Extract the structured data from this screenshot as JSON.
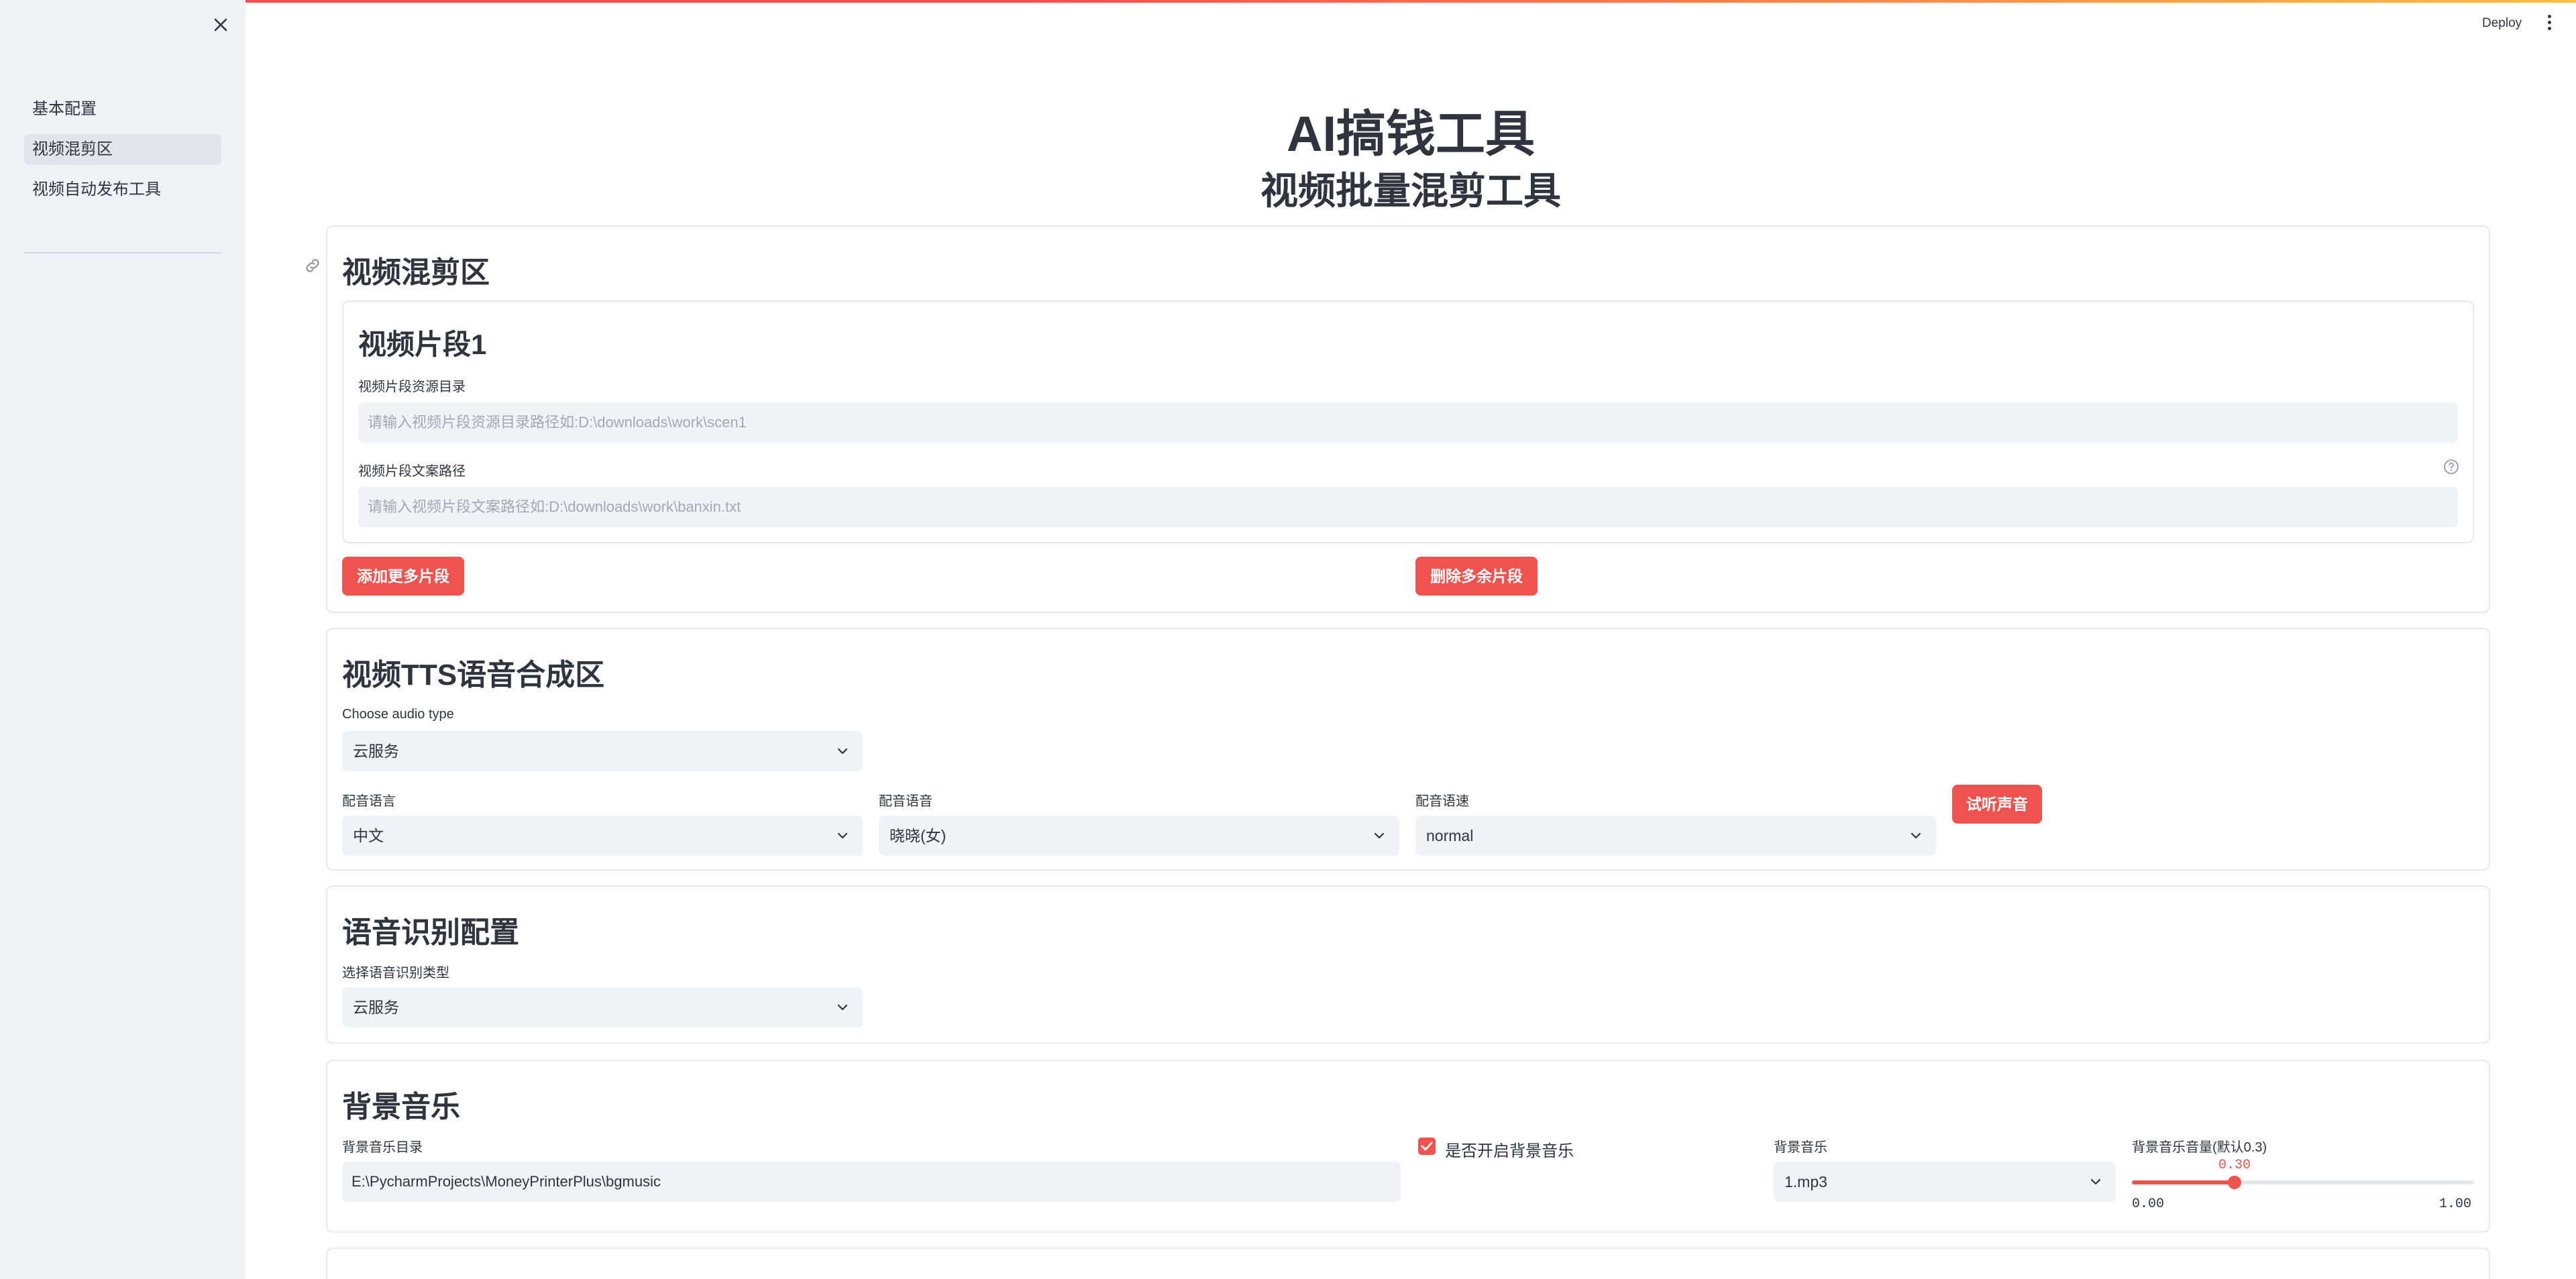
{
  "sidebar": {
    "close_icon": "close-icon",
    "items": [
      {
        "label": "基本配置",
        "active": false
      },
      {
        "label": "视频混剪区",
        "active": true
      },
      {
        "label": "视频自动发布工具",
        "active": false
      }
    ]
  },
  "header": {
    "deploy_label": "Deploy",
    "menu_icon": "vertical-dots-icon"
  },
  "page": {
    "title": "AI搞钱工具",
    "subtitle": "视频批量混剪工具"
  },
  "mix_section": {
    "title": "视频混剪区",
    "segment": {
      "title": "视频片段1",
      "dir_label": "视频片段资源目录",
      "dir_placeholder": "请输入视频片段资源目录路径如:D:\\downloads\\work\\scen1",
      "text_label": "视频片段文案路径",
      "text_placeholder": "请输入视频片段文案路径如:D:\\downloads\\work\\banxin.txt"
    },
    "add_button": "添加更多片段",
    "remove_button": "删除多余片段"
  },
  "tts_section": {
    "title": "视频TTS语音合成区",
    "audio_type_label": "Choose audio type",
    "audio_type_value": "云服务",
    "language_label": "配音语言",
    "language_value": "中文",
    "voice_label": "配音语音",
    "voice_value": "晓晓(女)",
    "speed_label": "配音语速",
    "speed_value": "normal",
    "preview_button": "试听声音"
  },
  "asr_section": {
    "title": "语音识别配置",
    "type_label": "选择语音识别类型",
    "type_value": "云服务"
  },
  "bgm_section": {
    "title": "背景音乐",
    "dir_label": "背景音乐目录",
    "dir_value": "E:\\PycharmProjects\\MoneyPrinterPlus\\bgmusic",
    "enable_label": "是否开启背景音乐",
    "enable_checked": true,
    "music_label": "背景音乐",
    "music_value": "1.mp3",
    "volume_label": "背景音乐音量(默认0.3)",
    "volume_value": "0.30",
    "volume_fraction": 0.3,
    "volume_min": "0.00",
    "volume_max": "1.00"
  },
  "colors": {
    "accent": "#ef5350",
    "sidebar_bg": "#f0f2f6",
    "input_bg": "#f0f2f6",
    "text": "#31333f"
  }
}
